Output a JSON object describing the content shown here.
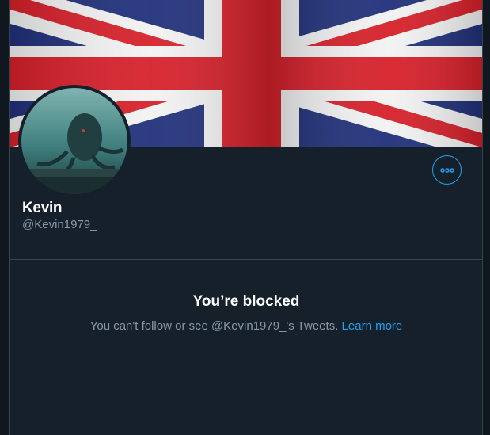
{
  "profile": {
    "banner": "union-jack-flag",
    "display_name": "Kevin",
    "handle": "@Kevin1979_",
    "more_icon": "more-horizontal-icon"
  },
  "blocked": {
    "title": "You’re blocked",
    "message_prefix": "You can't follow or see @Kevin1979_'s Tweets.",
    "link": "Learn more"
  },
  "colors": {
    "background": "#15202b",
    "border": "#38444d",
    "accent": "#1da1f2",
    "secondary_text": "#8899a6",
    "primary_text": "#ffffff"
  }
}
